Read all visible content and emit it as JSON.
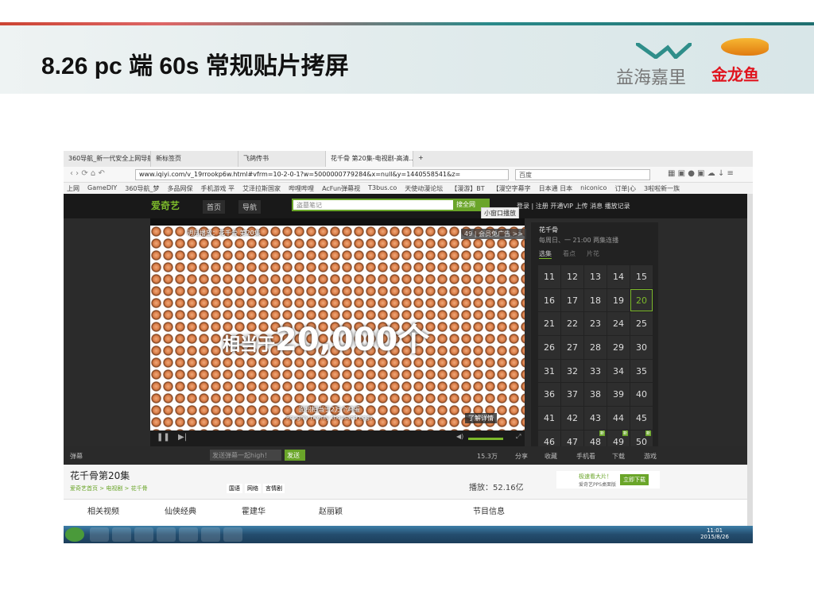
{
  "slide": {
    "title": "8.26 pc 端 60s 常规贴片拷屏",
    "logo_left": "益海嘉里",
    "logo_right": "金龙鱼"
  },
  "browser": {
    "tabs": [
      "360导航_新一代安全上网导航",
      "新标签页",
      "飞鸽传书",
      "花千骨 第20集-电视剧-高清..."
    ],
    "new_tab": "+",
    "url": "www.iqiyi.com/v_19rrookp6w.html#vfrm=10-2-0-1?w=5000000779284&x=null&y=1440558541&z=",
    "search_engine": "百度",
    "bookmarks": [
      "上网",
      "GameDIY",
      "360导航_梦",
      "多品网保",
      "手机游戏 平",
      "艾泽拉斯国家",
      "哔哩哔哩",
      "AcFun弹幕视",
      "T3bus.co",
      "天使动漫论坛",
      "【漫游】BT",
      "【漫空字幕字",
      "日本通 日本",
      "niconico",
      "订单|心",
      "3啦啦新一族"
    ]
  },
  "iqiyi": {
    "logo": "爱奇艺",
    "nav": [
      "首页",
      "导航"
    ],
    "search_placeholder": "盗墓笔记",
    "search_button": "搜全网",
    "header_links": "登录 | 注册  开通VIP  上传  消息  播放记录",
    "tooltip": "小窗口播放",
    "video_title": "明月播放：花千骨 第20集",
    "countdown": "49",
    "skip_ad": "会员免广告 >>",
    "ad_text_small": "相当于",
    "ad_text_big": "20,000个",
    "subtitle_cn": "面积相当于2万个鸡蛋",
    "subtitle_en": "Roughly twenty thousand eggs",
    "learn_more": "了解详情",
    "side_title": "花千骨",
    "side_schedule": "每周日、一 21:00 两集连播",
    "side_tabs": [
      "选集",
      "看点",
      "片花"
    ],
    "episodes": [
      "11",
      "12",
      "13",
      "14",
      "15",
      "16",
      "17",
      "18",
      "19",
      "20",
      "21",
      "22",
      "23",
      "24",
      "25",
      "26",
      "27",
      "28",
      "29",
      "30",
      "31",
      "32",
      "33",
      "34",
      "35",
      "36",
      "37",
      "38",
      "39",
      "40",
      "41",
      "42",
      "43",
      "44",
      "45",
      "46",
      "47",
      "48",
      "49",
      "50"
    ],
    "current_episode": "20",
    "new_badge": "新",
    "bar": {
      "danmu": "弹幕",
      "input_placeholder": "发送弹幕一起high！",
      "send": "发送",
      "likes": "15.3万",
      "share": "分享",
      "fav": "收藏",
      "phone": "手机看",
      "download": "下载",
      "game": "游戏"
    },
    "show_title": "花千骨第20集",
    "breadcrumb": "爱奇艺首页 > 电视剧 > 花千骨",
    "tags": [
      "国语",
      "网络",
      "言情剧"
    ],
    "plays": "播放：52.16亿",
    "promo": "极速看大片！",
    "promo_sub": "爱奇艺PPS桌面版",
    "promo_btn": "立即下载",
    "more": [
      "相关视频",
      "仙侠经典",
      "霍建华",
      "赵丽颖",
      "",
      "节目信息"
    ]
  },
  "taskbar": {
    "clock": "11:01",
    "date": "2015/8/26"
  }
}
